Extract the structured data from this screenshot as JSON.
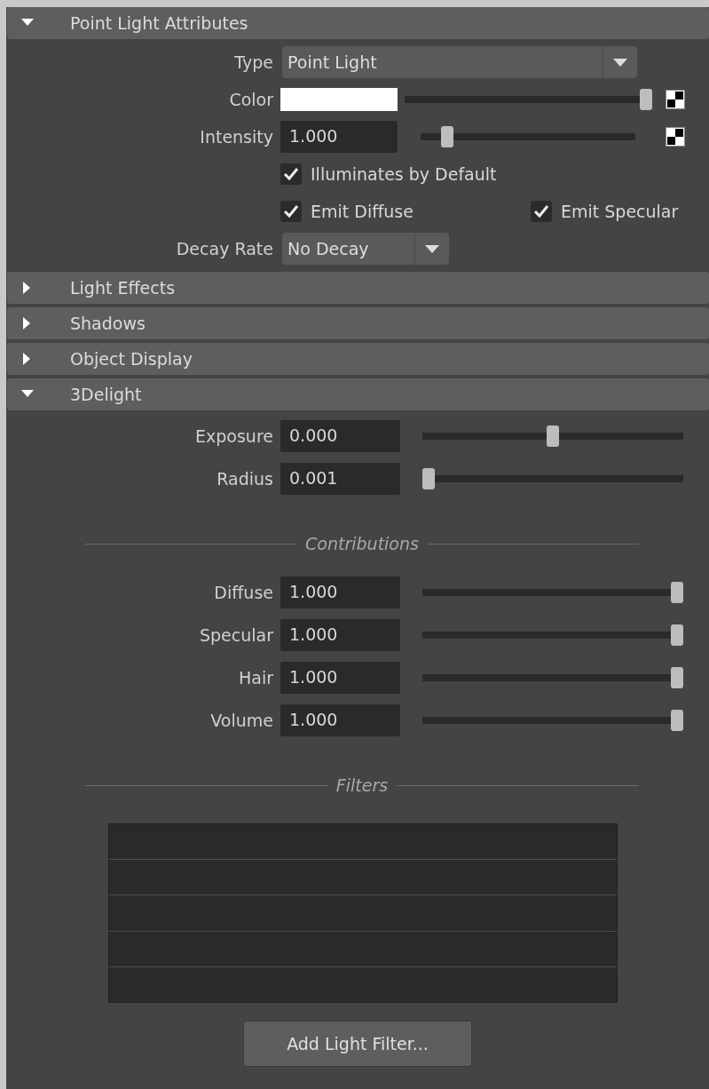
{
  "sections": [
    {
      "title": "Point Light Attributes",
      "expanded": true,
      "rows": [
        {
          "kind": "dropdown",
          "label": "Type",
          "value": "Point Light",
          "wide": true
        },
        {
          "kind": "color",
          "label": "Color",
          "color": "#ffffff",
          "level": 1,
          "map": true
        },
        {
          "kind": "number",
          "label": "Intensity",
          "value": "1.000",
          "level": 0.1,
          "map": true
        },
        {
          "kind": "checks",
          "items": [
            {
              "label": "Illuminates by Default",
              "checked": true
            }
          ]
        },
        {
          "kind": "checks",
          "items": [
            {
              "label": "Emit Diffuse",
              "checked": true
            },
            {
              "label": "Emit Specular",
              "checked": true
            }
          ]
        },
        {
          "kind": "dropdown",
          "label": "Decay Rate",
          "value": "No Decay",
          "wide": false
        }
      ]
    },
    {
      "title": "Light Effects",
      "expanded": false
    },
    {
      "title": "Shadows",
      "expanded": false
    },
    {
      "title": "Object Display",
      "expanded": false
    },
    {
      "title": "3Delight",
      "expanded": true,
      "rows": [
        {
          "kind": "number",
          "label": "Exposure",
          "value": "0.000",
          "level": 0.5,
          "map": false
        },
        {
          "kind": "number",
          "label": "Radius",
          "value": "0.001",
          "level": 0,
          "map": false
        },
        {
          "kind": "separator",
          "title": "Contributions"
        },
        {
          "kind": "number",
          "label": "Diffuse",
          "value": "1.000",
          "level": 1,
          "map": false
        },
        {
          "kind": "number",
          "label": "Specular",
          "value": "1.000",
          "level": 1,
          "map": false
        },
        {
          "kind": "number",
          "label": "Hair",
          "value": "1.000",
          "level": 1,
          "map": false
        },
        {
          "kind": "number",
          "label": "Volume",
          "value": "1.000",
          "level": 1,
          "map": false
        },
        {
          "kind": "separator",
          "title": "Filters"
        },
        {
          "kind": "list"
        },
        {
          "kind": "button",
          "label": "Add Light Filter..."
        }
      ]
    }
  ]
}
